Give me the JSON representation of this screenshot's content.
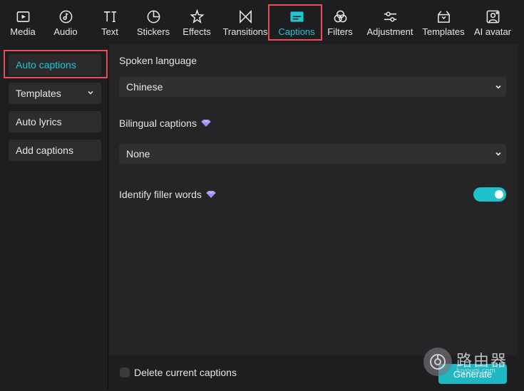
{
  "toolbar": {
    "items": [
      {
        "label": "Media",
        "icon": "media-icon"
      },
      {
        "label": "Audio",
        "icon": "audio-icon"
      },
      {
        "label": "Text",
        "icon": "text-icon"
      },
      {
        "label": "Stickers",
        "icon": "stickers-icon"
      },
      {
        "label": "Effects",
        "icon": "effects-icon"
      },
      {
        "label": "Transitions",
        "icon": "transitions-icon"
      },
      {
        "label": "Captions",
        "icon": "captions-icon"
      },
      {
        "label": "Filters",
        "icon": "filters-icon"
      },
      {
        "label": "Adjustment",
        "icon": "adjustment-icon"
      },
      {
        "label": "Templates",
        "icon": "templates-icon"
      },
      {
        "label": "AI avatar",
        "icon": "ai-avatar-icon"
      }
    ],
    "active": "Captions",
    "accent_color": "#22c6d2",
    "highlight_color": "#ea4e58"
  },
  "sidebar": {
    "items": [
      {
        "label": "Auto captions"
      },
      {
        "label": "Templates"
      },
      {
        "label": "Auto lyrics"
      },
      {
        "label": "Add captions"
      }
    ]
  },
  "main": {
    "spoken_language": {
      "label": "Spoken language",
      "value": "Chinese"
    },
    "bilingual": {
      "label": "Bilingual captions",
      "value": "None"
    },
    "filler": {
      "label": "Identify filler words",
      "enabled": true
    }
  },
  "footer": {
    "delete_label": "Delete current captions",
    "generate_label": "Generate"
  },
  "watermark": {
    "text": "路由器",
    "url": "luyouqi.com"
  }
}
